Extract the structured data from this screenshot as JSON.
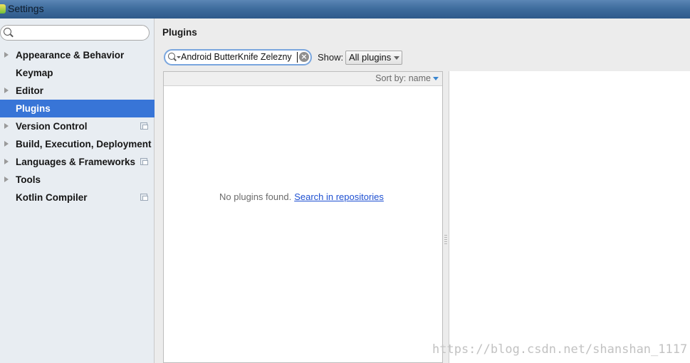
{
  "window": {
    "title": "Settings"
  },
  "sidebar": {
    "search": {
      "placeholder": ""
    },
    "items": [
      {
        "label": "Appearance & Behavior",
        "expandable": true,
        "selected": false,
        "project_icon": false
      },
      {
        "label": "Keymap",
        "expandable": false,
        "selected": false,
        "project_icon": false
      },
      {
        "label": "Editor",
        "expandable": true,
        "selected": false,
        "project_icon": false
      },
      {
        "label": "Plugins",
        "expandable": false,
        "selected": true,
        "project_icon": false
      },
      {
        "label": "Version Control",
        "expandable": true,
        "selected": false,
        "project_icon": true
      },
      {
        "label": "Build, Execution, Deployment",
        "expandable": true,
        "selected": false,
        "project_icon": false
      },
      {
        "label": "Languages & Frameworks",
        "expandable": true,
        "selected": false,
        "project_icon": true
      },
      {
        "label": "Tools",
        "expandable": true,
        "selected": false,
        "project_icon": false
      },
      {
        "label": "Kotlin Compiler",
        "expandable": false,
        "selected": false,
        "project_icon": true
      }
    ]
  },
  "main": {
    "title": "Plugins",
    "filter": {
      "value": "Android ButterKnife Zelezny"
    },
    "show": {
      "label": "Show:",
      "selected": "All plugins"
    },
    "list": {
      "sort_label": "Sort by: name",
      "empty_text": "No plugins found.",
      "empty_link": "Search in repositories"
    }
  },
  "watermark": "https://blog.csdn.net/shanshan_1117",
  "colors": {
    "selection": "#3875d7",
    "sidebar_bg": "#e8edf2",
    "link": "#1d4fd1",
    "sort_arrow": "#3a86d0"
  },
  "icons": {
    "search": "magnifier-icon",
    "clear": "clear-circle-icon",
    "tree_toggle": "triangle-right-icon",
    "project_level": "project-settings-icon"
  }
}
